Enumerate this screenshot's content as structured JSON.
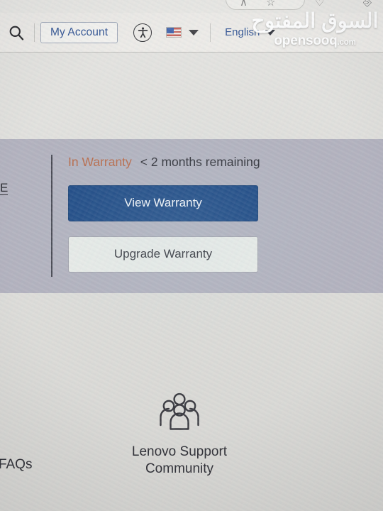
{
  "browser": {
    "toolbar_icons": [
      "bookmark-star-icon",
      "share-icon",
      "collections-icon",
      "split-screen-icon"
    ]
  },
  "header": {
    "search_icon": "search-icon",
    "account_button": "My Account",
    "accessibility_icon": "accessibility-icon",
    "flag": "us-flag-icon",
    "region_caret": "chevron-down-icon",
    "language": "English",
    "language_caret": "chevron-down-icon"
  },
  "watermark": {
    "arabic": "السوق المفتوح",
    "english": "opensooq",
    "tld": ".com"
  },
  "warranty": {
    "status": "In Warranty",
    "remaining": "< 2 months remaining",
    "view_button": "View Warranty",
    "upgrade_button": "Upgrade Warranty"
  },
  "clipped": {
    "left_link_fragment": "E"
  },
  "support": {
    "tiles": [
      {
        "label": "& FAQs",
        "icon": "document-icon",
        "clipped": true
      },
      {
        "label_line1": "Lenovo Support",
        "label_line2": "Community",
        "icon": "people-group-icon",
        "clipped": false
      }
    ]
  },
  "colors": {
    "accent_blue": "#274b8e",
    "primary_button": "#0f3d7c",
    "warranty_status": "#b4603c",
    "panel_bg": "#aeadba",
    "page_bg": "#dcdbd7"
  }
}
